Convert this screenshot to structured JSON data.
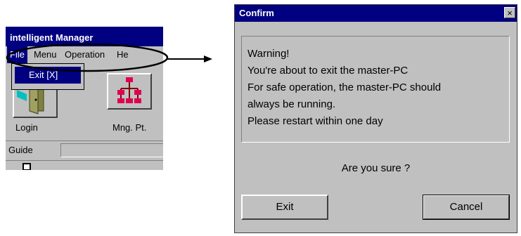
{
  "app": {
    "title": "intelligent Manager",
    "menu": [
      "File",
      "Menu",
      "Operation",
      "He"
    ],
    "file_menu": {
      "exit_label": "Exit",
      "exit_shortcut": "[X]"
    },
    "toolbar": [
      {
        "label": "Login",
        "icon": "door-icon"
      },
      {
        "label": "Mng. Pt.",
        "icon": "network-tree-icon"
      }
    ],
    "guide_label": "Guide"
  },
  "dialog": {
    "title": "Confirm",
    "close": "×",
    "message_lines": [
      "Warning!",
      "You're about to exit the master-PC",
      "For safe operation, the master-PC should",
      "always be running.",
      "Please restart within one day"
    ],
    "question": "Are you sure ?",
    "buttons": {
      "exit": "Exit",
      "cancel": "Cancel"
    }
  },
  "colors": {
    "titlebar": "#000080",
    "face": "#c0c0c0",
    "annotation": "#000000"
  }
}
